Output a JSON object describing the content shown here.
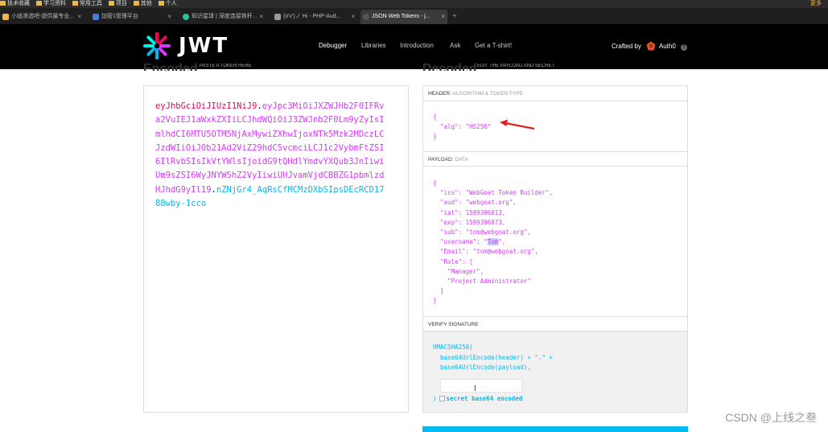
{
  "bookmarks": [
    "技术收藏",
    "学习资料",
    "常用工具",
    "项目",
    "其他",
    "个人"
  ],
  "bookmarks_right": "更多",
  "tabs": [
    {
      "label": "小迪渗透吧-提供最专业...",
      "active": false
    },
    {
      "label": "加密1管理平台",
      "active": false
    },
    {
      "label": "知识星球 | 深度连接铁杆...",
      "active": false
    },
    {
      "label": "(o'v')ノ Hi - PHP-Aud...",
      "active": false
    },
    {
      "label": "JSON Web Tokens - j...",
      "active": true
    }
  ],
  "header": {
    "logo_text": "JWT",
    "nav": [
      "Debugger",
      "Libraries",
      "Introduction",
      "Ask",
      "Get a T-shirt!"
    ],
    "crafted_by": "Crafted by",
    "brand": "Auth0"
  },
  "encoded": {
    "title": "Encoded",
    "subtitle": "PASTE A TOKEN HERE",
    "token_header": "eyJhbGciOiJIUzI1NiJ9",
    "token_payload": "eyJpc3MiOiJXZWJHb2F0IFRva2VuIEJ1aWxkZXIiLCJhdWQiOiJ3ZWJnb2F0Lm9yZyIsImlhdCI6MTU5OTM5NjAxMywiZXhwIjoxNTk5Mzk2MDczLCJzdWIiOiJ0b21Ad2ViZ29hdC5vcmciLCJ1c2VybmFtZSI6IlRvbSIsIkVtYWlsIjoidG9tQHdlYmdvYXQub3JnIiwiUm9sZSI6WyJNYW5hZ2VyIiwiUHJvamVjdCBBZG1pbmlzdHJhdG9yIl19",
    "token_signature": "nZNjGr4_AqRsCfMCMzDXbSIpsDEcRCD1788wby-1cco"
  },
  "decoded": {
    "title": "Decoded",
    "subtitle": "EDIT THE PAYLOAD AND SECRET",
    "header_label": "HEADER:",
    "header_sub": "ALGORITHM & TOKEN TYPE",
    "header_json": [
      "{",
      "  \"alg\": \"HS256\"",
      "}"
    ],
    "payload_label": "PAYLOAD:",
    "payload_sub": "DATA",
    "payload_json": [
      "{",
      "  \"iss\": \"WebGoat Token Builder\",",
      "  \"aud\": \"webgoat.org\",",
      "  \"iat\": 1599396013,",
      "  \"exp\": 1599396073,",
      "  \"sub\": \"tom@webgoat.org\",",
      "  \"username\": \"Tom\",",
      "  \"Email\": \"tom@webgoat.org\",",
      "  \"Role\": [",
      "    \"Manager\",",
      "    \"Project Administrator\"",
      "  ]",
      "}"
    ],
    "verify_label": "VERIFY SIGNATURE",
    "sig_lines": [
      "HMACSHA256(",
      "  base64UrlEncode(header) + \".\" +",
      "  base64UrlEncode(payload),"
    ],
    "secret_value": "",
    "sig_close": ")",
    "secret_label": "secret base64 encoded"
  },
  "watermark": "CSDN @上线之叁",
  "colors": {
    "header": "#fb015b",
    "payload": "#d63aff",
    "signature": "#00b9f1",
    "arrow": "#e02020"
  }
}
